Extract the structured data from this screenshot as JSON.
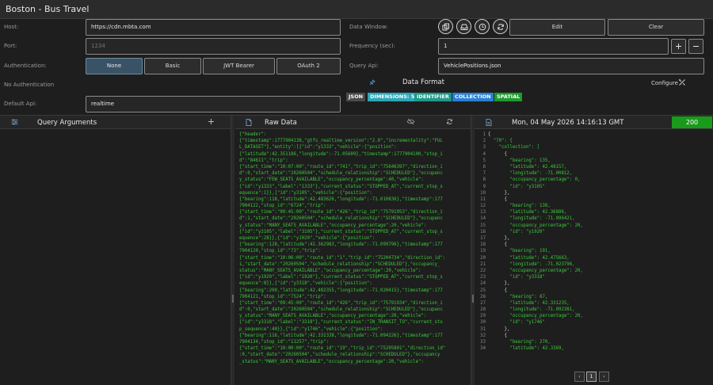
{
  "app": {
    "title": "Boston - Bus Travel"
  },
  "connection": {
    "host_label": "Host:",
    "host_value": "https://cdn.mbta.com",
    "port_label": "Port:",
    "port_placeholder": "1234",
    "auth_label": "Authentication:",
    "auth_options": [
      "None",
      "Basic",
      "JWT Bearer",
      "OAuth 2"
    ],
    "auth_selected": "None",
    "auth_status": "No Authentication",
    "default_api_label": "Default Api:",
    "default_api_value": "realtime"
  },
  "data_window": {
    "label": "Data Window:",
    "edit_label": "Edit",
    "clear_label": "Clear",
    "frequency_label": "Frequency (sec):",
    "frequency_value": "1",
    "query_api_label": "Query Api:",
    "query_api_value": "VehiclePositions.json"
  },
  "data_format": {
    "title": "Data Format",
    "configure_label": "Configure",
    "tags": [
      {
        "label": "JSON",
        "color": "#4a4a4a"
      },
      {
        "label": "DIMENSIONS: 5",
        "color": "#2aa7b8"
      },
      {
        "label": "IDENTIFIER",
        "color": "#1e9a88"
      },
      {
        "label": "COLLECTION",
        "color": "#2a7fd4"
      },
      {
        "label": "SPATIAL",
        "color": "#1e9a2e"
      }
    ]
  },
  "query_arguments": {
    "title": "Query Arguments"
  },
  "raw_data": {
    "title": "Raw Data",
    "lines": [
      "{\"header\":",
      "{\"timestamp\":1777904138,\"gtfs_realtime_version\":\"2.0\",\"incrementality\":\"FUL",
      "L_DATASET\"},\"entity\":[{\"id\":\"y1333\",\"vehicle\":{\"position\":",
      "{\"latitude\":42.351186,\"longitude\":-71.05609},\"timestamp\":1777904100,\"stop_i",
      "d\":\"84611\",\"trip\":",
      "{\"start_time\":\"10:07:00\",\"route_id\":\"741\",\"trip_id\":\"75646397\",\"direction_i",
      "d\":0,\"start_date\":\"20260504\",\"schedule_relationship\":\"SCHEDULED\"},\"occupanc",
      "y_status\":\"FEW_SEATS_AVAILABLE\",\"occupancy_percentage\":40,\"vehicle\":",
      "{\"id\":\"y1333\",\"label\":\"1333\"},\"current_status\":\"STOPPED_AT\",\"current_stop_s",
      "equence\":1}},{\"id\":\"y3105\",\"vehicle\":{\"position\":",
      "{\"bearing\":118,\"latitude\":42.483626,\"longitude\":-71.010836},\"timestamp\":177",
      "7904122,\"stop_id\":\"6724\",\"trip\":",
      "{\"start_time\":\"09:45:00\",\"route_id\":\"426\",\"trip_id\":\"75791953\",\"direction_i",
      "d\":1,\"start_date\":\"20260504\",\"schedule_relationship\":\"SCHEDULED\"},\"occupanc",
      "y_status\":\"MANY_SEATS_AVAILABLE\",\"occupancy_percentage\":20,\"vehicle\":",
      "{\"id\":\"y3105\",\"label\":\"3105\"},\"current_status\":\"STOPPED_AT\",\"current_stop_s",
      "equence\":28}},{\"id\":\"y1920\",\"vehicle\":{\"position\":",
      "{\"bearing\":128,\"latitude\":42.362983,\"longitude\":-71.099796},\"timestamp\":177",
      "7904120,\"stop_id\":\"73\",\"trip\":",
      "{\"start_time\":\"10:06:00\",\"route_id\":\"1\",\"trip_id\":\"75204734\",\"direction_id\":",
      "1,\"start_date\":\"20260504\",\"schedule_relationship\":\"SCHEDULED\"},\"occupancy_",
      "status\":\"MANY_SEATS_AVAILABLE\",\"occupancy_percentage\":20,\"vehicle\":",
      "{\"id\":\"y1920\",\"label\":\"1920\"},\"current_status\":\"STOPPED_AT\",\"current_stop_s",
      "equence\":8}},{\"id\":\"y3318\",\"vehicle\":{\"position\":",
      "{\"bearing\":200,\"latitude\":42.482355,\"longitude\":-71.020415},\"timestamp\":177",
      "7904121,\"stop_id\":\"7524\",\"trip\":",
      "{\"start_time\":\"09:45:00\",\"route_id\":\"426\",\"trip_id\":\"75791934\",\"direction_i",
      "d\":0,\"start_date\":\"20260504\",\"schedule_relationship\":\"SCHEDULED\"},\"occupanc",
      "y_status\":\"MANY_SEATS_AVAILABLE\",\"occupancy_percentage\":20,\"vehicle\":",
      "{\"id\":\"y3318\",\"label\":\"3318\"},\"current_status\":\"IN_TRANSIT_TO\",\"current_sto",
      "p_sequence\":40}},{\"id\":\"y1746\",\"vehicle\":{\"position\":",
      "{\"bearing\":116,\"latitude\":42.331338,\"longitude\":-71.094226},\"timestamp\":177",
      "7904134,\"stop_id\":\"11257\",\"trip\":",
      "{\"start_time\":\"10:00:00\",\"route_id\":\"19\",\"trip_id\":\"75205801\",\"direction_id\"",
      ":0,\"start_date\":\"20260504\",\"schedule_relationship\":\"SCHEDULED\"},\"occupancy",
      "_status\":\"MANY_SEATS_AVAILABLE\",\"occupancy_percentage\":20,\"vehicle\":"
    ]
  },
  "result": {
    "title": "Mon, 04 May 2026 14:16:13 GMT",
    "status_code": "200",
    "status_color": "#1a9a1a",
    "line_numbers": [
      "1",
      "2",
      "3",
      "4",
      "5",
      "6",
      "7",
      "8",
      "9",
      "10",
      "11",
      "12",
      "13",
      "14",
      "15",
      "16",
      "17",
      "18",
      "19",
      "20",
      "21",
      "22",
      "23",
      "24",
      "25",
      "26",
      "27",
      "28",
      "29",
      "30",
      "31",
      "32",
      "33",
      "34"
    ],
    "lines": [
      "{",
      "  \"70\": {",
      "    \"collection\": [",
      "      {",
      "        \"bearing\": 135,",
      "        \"latitude\": 42.48157,",
      "        \"longitude\": -71.00812,",
      "        \"occupancy_percentage\": 0,",
      "        \"id\": \"y3105\"",
      "      },",
      "      {",
      "        \"bearing\": 138,",
      "        \"latitude\": 42.36886,",
      "        \"longitude\": -71.096421,",
      "        \"occupancy_percentage\": 20,",
      "        \"id\": \"y1920\"",
      "      },",
      "      {",
      "        \"bearing\": 191,",
      "        \"latitude\": 42.475663,",
      "        \"longitude\": -71.023796,",
      "        \"occupancy_percentage\": 20,",
      "        \"id\": \"y3318\"",
      "      },",
      "      {",
      "        \"bearing\": 87,",
      "        \"latitude\": 42.331235,",
      "        \"longitude\": -71.092381,",
      "        \"occupancy_percentage\": 20,",
      "        \"id\": \"y1746\"",
      "      },",
      "      {",
      "        \"bearing\": 270,",
      "        \"latitude\": 42.3369,"
    ],
    "pagination": {
      "prev": "‹",
      "page": "1",
      "next": "›"
    }
  }
}
